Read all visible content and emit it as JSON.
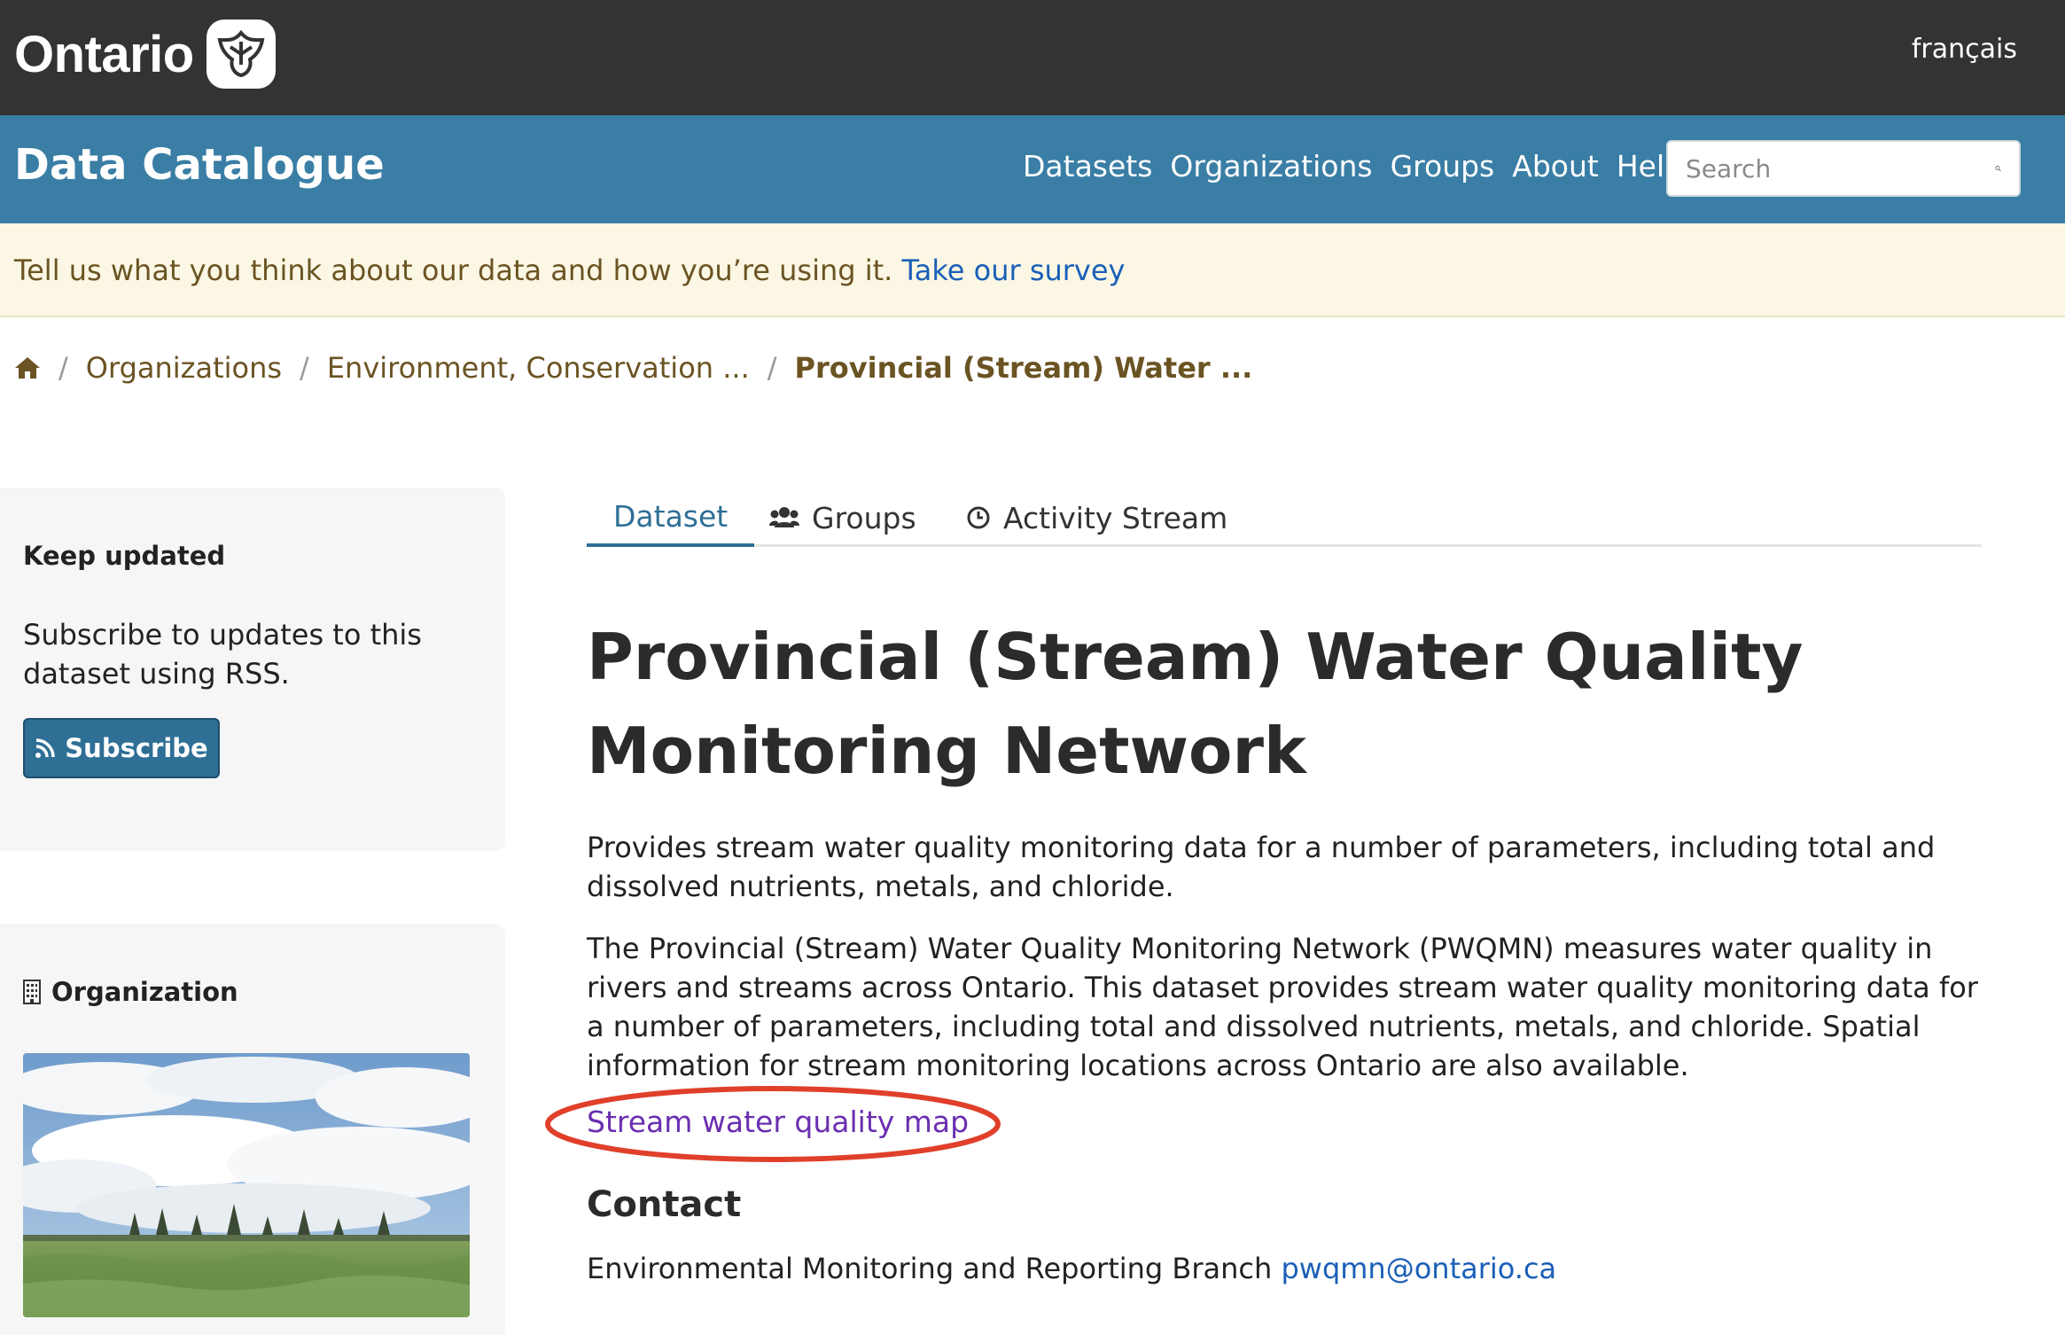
{
  "topbar": {
    "logo_text": "Ontario",
    "language_link": "français"
  },
  "navbar": {
    "site_title": "Data Catalogue",
    "links": [
      "Datasets",
      "Organizations",
      "Groups",
      "About",
      "Help"
    ],
    "search_placeholder": "Search"
  },
  "banner": {
    "text": "Tell us what you think about our data and how you’re using it.",
    "link": "Take our survey"
  },
  "breadcrumb": {
    "items": [
      "Organizations",
      "Environment, Conservation ..."
    ],
    "current": "Provincial (Stream) Water ..."
  },
  "sidebar": {
    "keep_updated": {
      "heading": "Keep updated",
      "text": "Subscribe to updates to this dataset using RSS.",
      "button": "Subscribe"
    },
    "organization": {
      "heading": "Organization"
    }
  },
  "tabs": [
    "Dataset",
    "Groups",
    "Activity Stream"
  ],
  "main": {
    "title": "Provincial (Stream) Water Quality Monitoring Network",
    "paragraph1": "Provides stream water quality monitoring data for a number of parameters, including total and dissolved nutrients, metals, and chloride.",
    "paragraph2": "The Provincial (Stream) Water Quality Monitoring Network (PWQMN) measures water quality in rivers and streams across Ontario. This dataset provides stream water quality monitoring data for a number of parameters, including total and dissolved nutrients, metals, and chloride. Spatial information for stream monitoring locations across Ontario are also available.",
    "map_link": "Stream water quality map",
    "contact_heading": "Contact",
    "contact_text": "Environmental Monitoring and Reporting Branch",
    "contact_email": "pwqmn@ontario.ca"
  },
  "colors": {
    "topbar": "#333333",
    "navbar": "#3a7ea5",
    "banner": "#fbf7e4",
    "annotation_ellipse": "#e0402b",
    "visited_link": "#6a2fb0"
  }
}
